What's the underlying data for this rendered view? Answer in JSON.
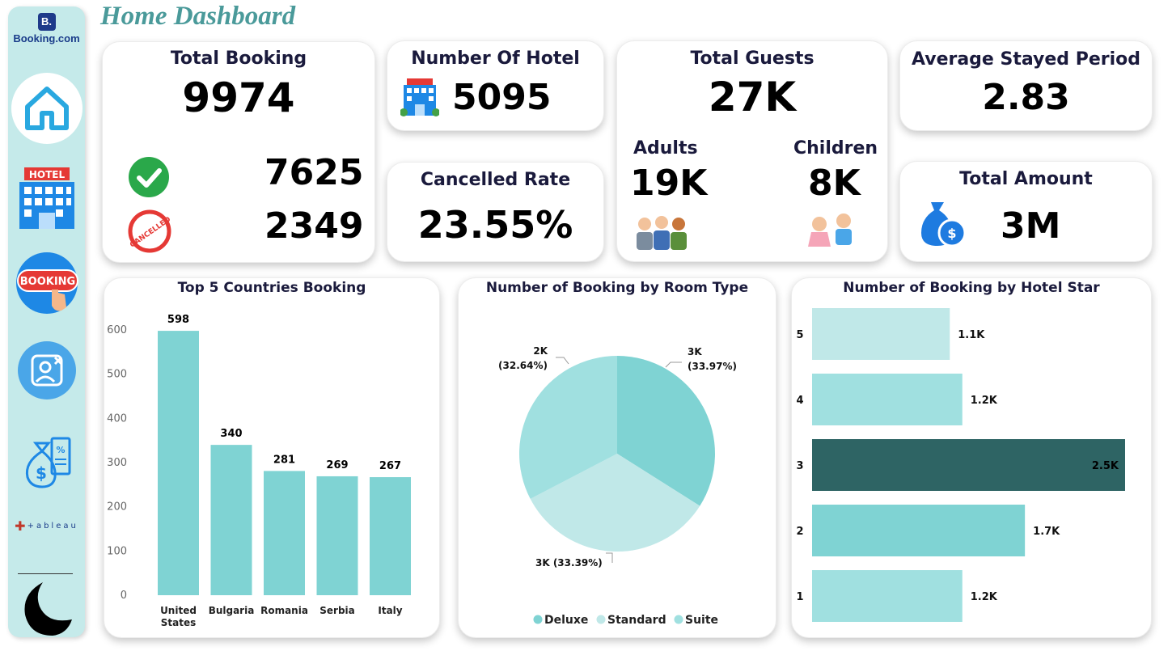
{
  "app": {
    "logo_text": "Booking.com",
    "logo_letter": "B."
  },
  "page_title": "Home Dashboard",
  "kpis": {
    "total_booking": {
      "label": "Total Booking",
      "value": "9974",
      "completed": "7625",
      "cancelled": "2349"
    },
    "number_of_hotel": {
      "label": "Number Of Hotel",
      "value": "5095"
    },
    "cancelled_rate": {
      "label": "Cancelled Rate",
      "value": "23.55%"
    },
    "total_guests": {
      "label": "Total Guests",
      "value": "27K",
      "adults_label": "Adults",
      "adults_value": "19K",
      "children_label": "Children",
      "children_value": "8K"
    },
    "avg_stayed": {
      "label": "Average Stayed Period",
      "value": "2.83"
    },
    "total_amount": {
      "label": "Total Amount",
      "value": "3M"
    }
  },
  "sidebar": {
    "items": [
      {
        "name": "home-icon"
      },
      {
        "name": "hotel-icon"
      },
      {
        "name": "booking-icon"
      },
      {
        "name": "cancel-user-icon"
      },
      {
        "name": "money-bag-icon"
      },
      {
        "name": "tableau-icon",
        "label": "+ableau"
      },
      {
        "name": "moon-icon"
      }
    ],
    "hotel_sign": "HOTEL",
    "booking_sign": "BOOKING",
    "cancelled_stamp": "CANCELLED"
  },
  "colors": {
    "accent": "#7fd3d3",
    "dark": "#2e6464",
    "light": "#c0e8e8",
    "mid": "#a0e0e0",
    "title": "#4a9a9a"
  },
  "chart_data": [
    {
      "type": "bar",
      "title": "Top 5 Countries Booking",
      "categories": [
        "United States",
        "Bulgaria",
        "Romania",
        "Serbia",
        "Italy"
      ],
      "category_lines": [
        [
          "United",
          "States"
        ],
        [
          "Bulgaria"
        ],
        [
          "Romania"
        ],
        [
          "Serbia"
        ],
        [
          "Italy"
        ]
      ],
      "values": [
        598,
        340,
        281,
        269,
        267
      ],
      "ylim": [
        0,
        600
      ],
      "yticks": [
        0,
        100,
        200,
        300,
        400,
        500,
        600
      ],
      "grid": false
    },
    {
      "type": "pie",
      "title": "Number of Booking by Room Type",
      "labels": [
        "Deluxe",
        "Standard",
        "Suite"
      ],
      "percent": [
        33.97,
        33.39,
        32.64
      ],
      "data_labels": [
        "3K\n(33.97%)",
        "3K (33.39%)",
        "2K\n(32.64%)"
      ],
      "colors": [
        "#7fd3d3",
        "#c0e8e8",
        "#a0e0e0"
      ],
      "legend": {
        "position": "bottom",
        "entries": [
          "Deluxe",
          "Standard",
          "Suite"
        ]
      }
    },
    {
      "type": "bar",
      "orientation": "horizontal",
      "title": "Number of Booking by Hotel Star",
      "categories": [
        "5",
        "4",
        "3",
        "2",
        "1"
      ],
      "values": [
        1100,
        1200,
        2500,
        1700,
        1200
      ],
      "data_labels": [
        "1.1K",
        "1.2K",
        "2.5K",
        "1.7K",
        "1.2K"
      ],
      "colors": [
        "#c0e8e8",
        "#a0e0e0",
        "#2e6464",
        "#7fd3d3",
        "#a0e0e0"
      ],
      "xlim": [
        0,
        2500
      ]
    }
  ]
}
